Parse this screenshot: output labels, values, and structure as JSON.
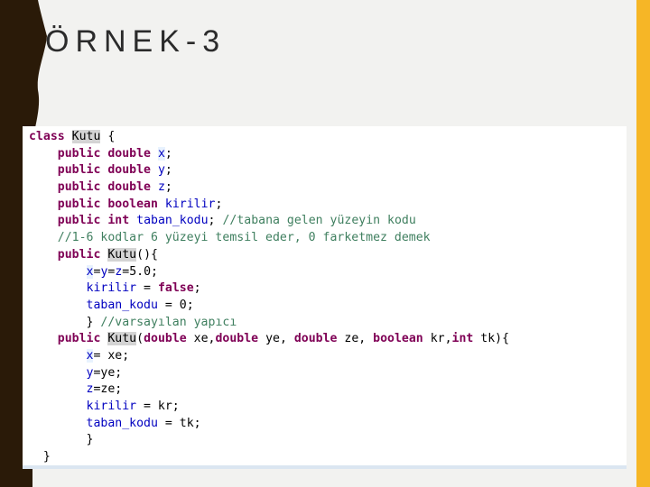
{
  "slide": {
    "title": "ÖRNEK-3",
    "colors": {
      "left_band": "#2a1a08",
      "accent_bar": "#f6b626",
      "background": "#f2f2f0"
    }
  },
  "code": {
    "colors": {
      "keyword": "#7f0055",
      "field": "#0000c0",
      "comment": "#3f7f5f",
      "text": "#000000"
    },
    "lines": [
      [
        {
          "k": "kw",
          "t": "class"
        },
        {
          "t": " "
        },
        {
          "k": "hl",
          "t": "Kutu"
        },
        {
          "t": " {"
        }
      ],
      [
        {
          "t": "    "
        },
        {
          "k": "kw",
          "t": "public"
        },
        {
          "t": " "
        },
        {
          "k": "kw",
          "t": "double"
        },
        {
          "t": " "
        },
        {
          "k": "field occ",
          "t": "x"
        },
        {
          "t": ";"
        }
      ],
      [
        {
          "t": "    "
        },
        {
          "k": "kw",
          "t": "public"
        },
        {
          "t": " "
        },
        {
          "k": "kw",
          "t": "double"
        },
        {
          "t": " "
        },
        {
          "k": "field",
          "t": "y"
        },
        {
          "t": ";"
        }
      ],
      [
        {
          "t": "    "
        },
        {
          "k": "kw",
          "t": "public"
        },
        {
          "t": " "
        },
        {
          "k": "kw",
          "t": "double"
        },
        {
          "t": " "
        },
        {
          "k": "field",
          "t": "z"
        },
        {
          "t": ";"
        }
      ],
      [
        {
          "t": "    "
        },
        {
          "k": "kw",
          "t": "public"
        },
        {
          "t": " "
        },
        {
          "k": "kw",
          "t": "boolean"
        },
        {
          "t": " "
        },
        {
          "k": "field",
          "t": "kirilir"
        },
        {
          "t": ";"
        }
      ],
      [
        {
          "t": "    "
        },
        {
          "k": "kw",
          "t": "public"
        },
        {
          "t": " "
        },
        {
          "k": "kw",
          "t": "int"
        },
        {
          "t": " "
        },
        {
          "k": "field",
          "t": "taban_kodu"
        },
        {
          "t": "; "
        },
        {
          "k": "cmt",
          "t": "//tabana gelen yüzeyin kodu"
        }
      ],
      [
        {
          "t": "    "
        },
        {
          "k": "cmt",
          "t": "//1-6 kodlar 6 yüzeyi temsil eder, 0 farketmez demek"
        }
      ],
      [
        {
          "t": "    "
        },
        {
          "k": "kw",
          "t": "public"
        },
        {
          "t": " "
        },
        {
          "k": "hl",
          "t": "Kutu"
        },
        {
          "t": "(){"
        }
      ],
      [
        {
          "t": "        "
        },
        {
          "k": "field occ",
          "t": "x"
        },
        {
          "t": "="
        },
        {
          "k": "field",
          "t": "y"
        },
        {
          "t": "="
        },
        {
          "k": "field",
          "t": "z"
        },
        {
          "t": "=5.0;"
        }
      ],
      [
        {
          "t": "        "
        },
        {
          "k": "field",
          "t": "kirilir"
        },
        {
          "t": " = "
        },
        {
          "k": "kw",
          "t": "false"
        },
        {
          "t": ";"
        }
      ],
      [
        {
          "t": "        "
        },
        {
          "k": "field",
          "t": "taban_kodu"
        },
        {
          "t": " = 0;"
        }
      ],
      [
        {
          "t": "        } "
        },
        {
          "k": "cmt",
          "t": "//varsayılan yapıcı"
        }
      ],
      [
        {
          "t": "    "
        },
        {
          "k": "kw",
          "t": "public"
        },
        {
          "t": " "
        },
        {
          "k": "hl",
          "t": "Kutu"
        },
        {
          "t": "("
        },
        {
          "k": "kw",
          "t": "double"
        },
        {
          "t": " xe,"
        },
        {
          "k": "kw",
          "t": "double"
        },
        {
          "t": " ye, "
        },
        {
          "k": "kw",
          "t": "double"
        },
        {
          "t": " ze, "
        },
        {
          "k": "kw",
          "t": "boolean"
        },
        {
          "t": " kr,"
        },
        {
          "k": "kw",
          "t": "int"
        },
        {
          "t": " tk){"
        }
      ],
      [
        {
          "t": "        "
        },
        {
          "k": "field occ",
          "t": "x"
        },
        {
          "t": "= xe;"
        }
      ],
      [
        {
          "t": "        "
        },
        {
          "k": "field",
          "t": "y"
        },
        {
          "t": "=ye;"
        }
      ],
      [
        {
          "t": "        "
        },
        {
          "k": "field",
          "t": "z"
        },
        {
          "t": "=ze;"
        }
      ],
      [
        {
          "t": "        "
        },
        {
          "k": "field",
          "t": "kirilir"
        },
        {
          "t": " = kr;"
        }
      ],
      [
        {
          "t": "        "
        },
        {
          "k": "field",
          "t": "taban_kodu"
        },
        {
          "t": " = tk;"
        }
      ],
      [
        {
          "t": "        }"
        }
      ],
      [
        {
          "t": "  }"
        }
      ]
    ]
  }
}
